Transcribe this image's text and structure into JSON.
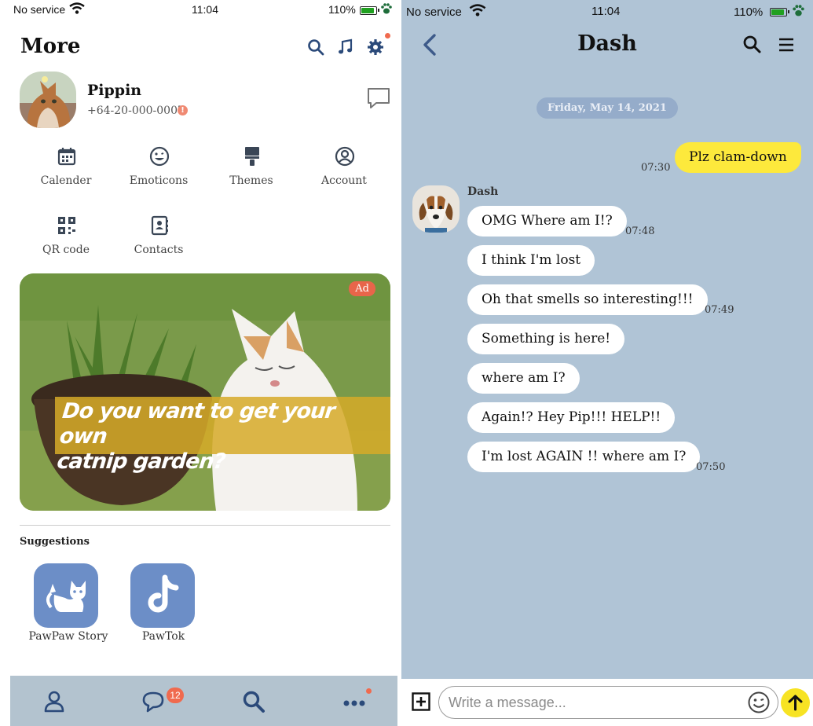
{
  "left": {
    "status": {
      "carrier": "No service",
      "time": "11:04",
      "battery": "110%",
      "battery_level": 0.8
    },
    "title": "More",
    "profile": {
      "name": "Pippin",
      "phone": "+64-20-000-0007",
      "warning_glyph": "!"
    },
    "menu": [
      {
        "label": "Calender",
        "icon": "calendar-icon"
      },
      {
        "label": "Emoticons",
        "icon": "smiley-icon"
      },
      {
        "label": "Themes",
        "icon": "brush-icon"
      },
      {
        "label": "Account",
        "icon": "account-icon"
      },
      {
        "label": "QR code",
        "icon": "qr-code-icon"
      },
      {
        "label": "Contacts",
        "icon": "contacts-icon"
      }
    ],
    "ad": {
      "badge": "Ad",
      "headline_line1": "Do you want to get your own",
      "headline_line2": "catnip garden?"
    },
    "suggestions": {
      "title": "Suggestions",
      "apps": [
        {
          "label": "PawPaw Story",
          "icon": "cat-icon"
        },
        {
          "label": "PawTok",
          "icon": "music-note-icon"
        }
      ]
    },
    "tabbar": {
      "chat_badge": "12"
    }
  },
  "right": {
    "status": {
      "carrier": "No service",
      "time": "11:04",
      "battery": "110%",
      "battery_level": 0.8
    },
    "title": "Dash",
    "date": "Friday, May 14, 2021",
    "sender": "Dash",
    "outgoing": {
      "text": "Plz clam-down",
      "time": "07:30"
    },
    "messages": [
      {
        "text": "OMG Where am I!?",
        "time": "07:48"
      },
      {
        "text": "I think I'm lost",
        "time": ""
      },
      {
        "text": "Oh that smells so interesting!!!",
        "time": "07:49"
      },
      {
        "text": "Something is here!",
        "time": ""
      },
      {
        "text": "where am I?",
        "time": ""
      },
      {
        "text": "Again!? Hey Pip!!! HELP!!",
        "time": ""
      },
      {
        "text": "I'm lost AGAIN !! where am I?",
        "time": "07:50"
      }
    ],
    "composer": {
      "placeholder": "Write a message..."
    }
  },
  "colors": {
    "accent": "#3d5a8a",
    "chat_bg": "#b0c4d6",
    "my_bubble": "#fde93c",
    "badge": "#f06a4e",
    "app_tile": "#6c8ec7",
    "tabbar": "#b3c3cf"
  }
}
